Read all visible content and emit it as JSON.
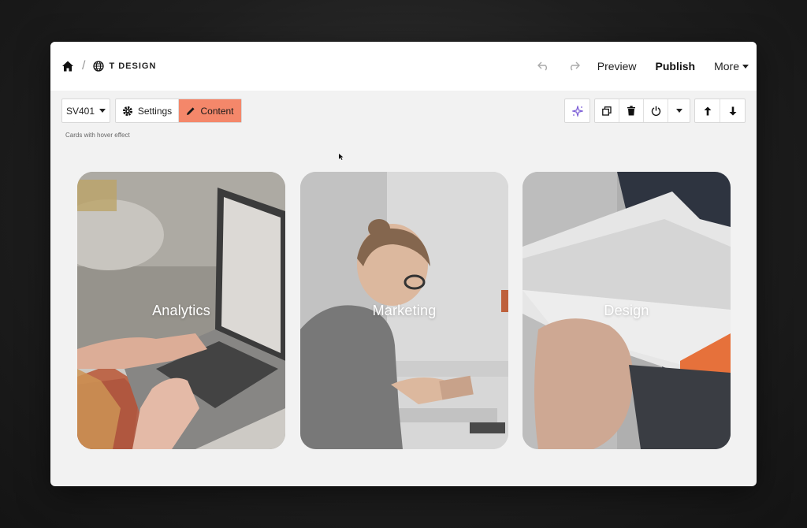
{
  "topbar": {
    "site_name": "T DESIGN",
    "preview_label": "Preview",
    "publish_label": "Publish",
    "more_label": "More"
  },
  "toolbar": {
    "variant_label": "SV401",
    "settings_label": "Settings",
    "content_label": "Content"
  },
  "block": {
    "description": "Cards with hover effect"
  },
  "cards": [
    {
      "title": "Analytics"
    },
    {
      "title": "Marketing"
    },
    {
      "title": "Design"
    }
  ],
  "colors": {
    "accent": "#f4876a",
    "ai_icon": "#7b5cd6"
  }
}
